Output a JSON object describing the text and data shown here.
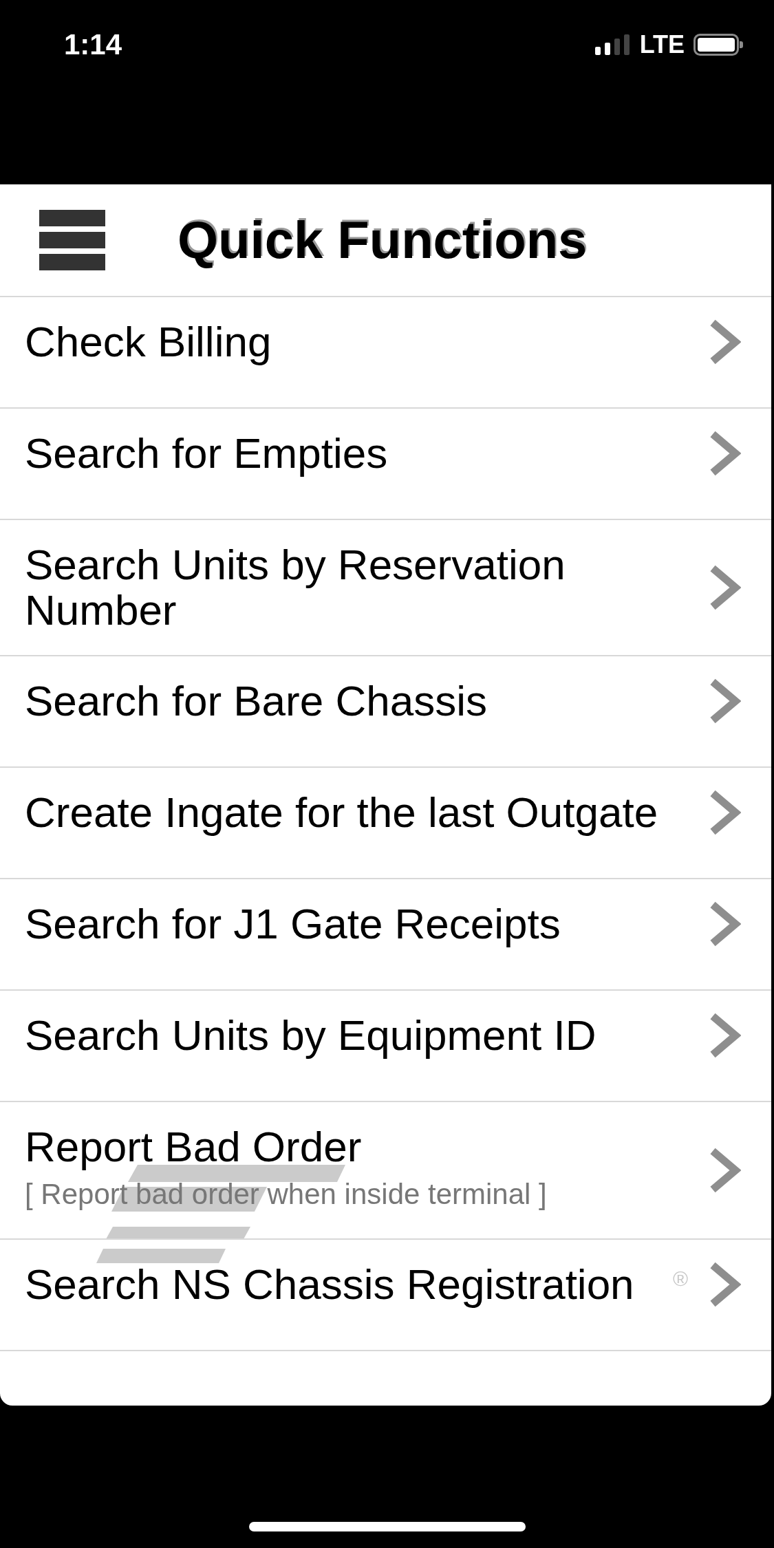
{
  "status_bar": {
    "time": "1:14",
    "network": "LTE"
  },
  "header": {
    "title": "Quick Functions"
  },
  "items": [
    {
      "title": "Check Billing"
    },
    {
      "title": "Search for Empties"
    },
    {
      "title": "Search Units by Reservation Number"
    },
    {
      "title": "Search for Bare Chassis"
    },
    {
      "title": "Create Ingate for the last Outgate"
    },
    {
      "title": "Search for J1 Gate Receipts"
    },
    {
      "title": "Search Units by Equipment ID"
    },
    {
      "title": "Report Bad Order",
      "subtitle": "[ Report bad order when inside terminal ]"
    },
    {
      "title": "Search NS Chassis Registration"
    }
  ],
  "background_logo": {
    "registered_mark": "®"
  }
}
